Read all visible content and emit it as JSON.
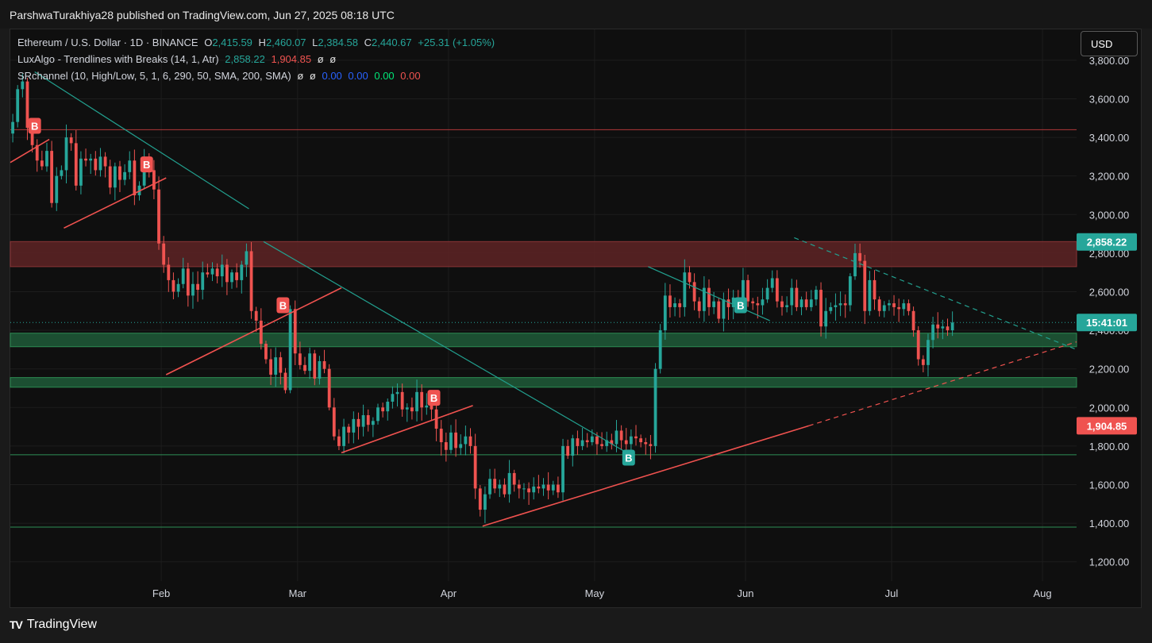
{
  "header": {
    "published_by": "ParshwaTurakhiya28 published on TradingView.com, Jun 27, 2025 08:18 UTC"
  },
  "legend": {
    "symbol": "Ethereum / U.S. Dollar · 1D · BINANCE",
    "o_label": "O",
    "o_value": "2,415.59",
    "h_label": "H",
    "h_value": "2,460.07",
    "l_label": "L",
    "l_value": "2,384.58",
    "c_label": "C",
    "c_value": "2,440.67",
    "change": "+25.31 (+1.05%)",
    "indicator1_name": "LuxAlgo - Trendlines with Breaks (14, 1, Atr)",
    "indicator1_v1": "2,858.22",
    "indicator1_v2": "1,904.85",
    "indicator1_v3": "ø",
    "indicator1_v4": "ø",
    "indicator2_name": "SRchannel (10, High/Low, 5, 1, 6, 290, 50, SMA, 200, SMA)",
    "indicator2_v1": "ø",
    "indicator2_v2": "ø",
    "indicator2_v3": "0.00",
    "indicator2_v4": "0.00",
    "indicator2_v5": "0.00",
    "indicator2_v6": "0.00"
  },
  "currency_button": "USD",
  "footer": {
    "logo": "TV",
    "name": "TradingView"
  },
  "colors": {
    "up": "#26a69a",
    "down": "#ef5350",
    "teal_line": "#22a08f",
    "red_line": "#f0524f",
    "zone_red": "#5e2325",
    "zone_green": "#1e5b38",
    "background": "#0f0f0f"
  },
  "chart_data": {
    "type": "candlestick",
    "symbol": "Ethereum / U.S. Dollar",
    "interval": "1D",
    "exchange": "BINANCE",
    "ylim": [
      1100,
      3960
    ],
    "y_ticks": [
      3800,
      3600,
      3400,
      3200,
      3000,
      2800,
      2600,
      2400,
      2200,
      2000,
      1800,
      1600,
      1400,
      1200
    ],
    "y_tick_labels": [
      "3,800.00",
      "3,600.00",
      "3,400.00",
      "3,200.00",
      "3,000.00",
      "2,800.00",
      "2,600.00",
      "2,400.00",
      "2,200.00",
      "2,000.00",
      "1,800.00",
      "1,600.00",
      "1,400.00",
      "1,200.00"
    ],
    "x_labels": [
      {
        "label": "Feb",
        "date": "2025-02-01"
      },
      {
        "label": "Mar",
        "date": "2025-03-01"
      },
      {
        "label": "Apr",
        "date": "2025-04-01"
      },
      {
        "label": "May",
        "date": "2025-05-01"
      },
      {
        "label": "Jun",
        "date": "2025-06-01"
      },
      {
        "label": "Jul",
        "date": "2025-07-01"
      },
      {
        "label": "Aug",
        "date": "2025-08-01"
      }
    ],
    "x_range": [
      "2025-01-01",
      "2025-08-08"
    ],
    "price_tags": [
      {
        "value": 2858.22,
        "label": "2,858.22",
        "color": "#26a69a"
      },
      {
        "value": 2440.67,
        "label": "15:41:01",
        "color": "#26a69a"
      },
      {
        "value": 1904.85,
        "label": "1,904.85",
        "color": "#ef5350"
      }
    ],
    "last_price": 2440.67,
    "closes": [
      3480,
      3650,
      3690,
      3450,
      3360,
      3280,
      3250,
      3330,
      3060,
      3200,
      3230,
      3400,
      3370,
      3150,
      3290,
      3280,
      3290,
      3230,
      3300,
      3250,
      3140,
      3250,
      3180,
      3220,
      3280,
      3100,
      3150,
      3300,
      3230,
      3130,
      2850,
      2740,
      2660,
      2600,
      2640,
      2720,
      2580,
      2640,
      2610,
      2700,
      2690,
      2720,
      2680,
      2740,
      2650,
      2700,
      2660,
      2740,
      2810,
      2500,
      2450,
      2330,
      2250,
      2170,
      2260,
      2180,
      2090,
      2510,
      2280,
      2220,
      2190,
      2280,
      2150,
      2240,
      2200,
      2000,
      1850,
      1800,
      1900,
      1870,
      1940,
      1900,
      1960,
      1910,
      1930,
      2000,
      1980,
      2030,
      2070,
      2080,
      1990,
      2000,
      1980,
      2080,
      2000,
      2010,
      1990,
      1890,
      1820,
      1780,
      1870,
      1790,
      1810,
      1850,
      1800,
      1580,
      1470,
      1550,
      1630,
      1580,
      1600,
      1550,
      1660,
      1600,
      1580,
      1580,
      1560,
      1590,
      1580,
      1600,
      1570,
      1600,
      1560,
      1800,
      1750,
      1840,
      1800,
      1830,
      1820,
      1850,
      1810,
      1800,
      1830,
      1810,
      1880,
      1830,
      1810,
      1850,
      1840,
      1820,
      1810,
      1800,
      2200,
      2400,
      2580,
      2520,
      2540,
      2520,
      2700,
      2650,
      2550,
      2500,
      2620,
      2520,
      2550,
      2460,
      2560,
      2520,
      2570,
      2560,
      2660,
      2550,
      2540,
      2530,
      2560,
      2620,
      2670,
      2550,
      2520,
      2530,
      2620,
      2520,
      2560,
      2520,
      2560,
      2610,
      2420,
      2500,
      2520,
      2530,
      2540,
      2530,
      2680,
      2800,
      2760,
      2500,
      2660,
      2560,
      2500,
      2530,
      2540,
      2520,
      2510,
      2540,
      2500,
      2400,
      2250,
      2220,
      2350,
      2430,
      2410,
      2420,
      2400,
      2440
    ],
    "zones": [
      {
        "type": "resistance",
        "low": 2730,
        "high": 2860
      },
      {
        "type": "support",
        "low": 2315,
        "high": 2385
      },
      {
        "type": "support",
        "low": 2105,
        "high": 2155
      }
    ],
    "horizontal_lines": [
      3440,
      1755,
      1380
    ],
    "trendlines": [
      {
        "color": "teal",
        "from": [
          "2025-01-06",
          3740
        ],
        "to": [
          "2025-02-19",
          3030
        ]
      },
      {
        "color": "teal",
        "from": [
          "2025-02-22",
          2860
        ],
        "to": [
          "2025-05-08",
          1760
        ]
      },
      {
        "color": "teal",
        "from": [
          "2025-05-12",
          2730
        ],
        "to": [
          "2025-06-06",
          2450
        ]
      },
      {
        "color": "teal",
        "style": "dashed",
        "from": [
          "2025-06-11",
          2880
        ],
        "to": [
          "2025-08-08",
          2300
        ]
      },
      {
        "color": "red",
        "from": [
          "2025-01-01",
          3270
        ],
        "to": [
          "2025-01-09",
          3390
        ]
      },
      {
        "color": "red",
        "from": [
          "2025-01-12",
          2930
        ],
        "to": [
          "2025-02-02",
          3190
        ]
      },
      {
        "color": "red",
        "from": [
          "2025-02-02",
          2170
        ],
        "to": [
          "2025-03-10",
          2620
        ]
      },
      {
        "color": "red",
        "from": [
          "2025-03-10",
          1765
        ],
        "to": [
          "2025-04-06",
          2010
        ]
      },
      {
        "color": "red",
        "from": [
          "2025-04-08",
          1385
        ],
        "to": [
          "2025-06-14",
          1905
        ]
      },
      {
        "color": "red",
        "style": "dashed",
        "from": [
          "2025-06-14",
          1905
        ],
        "to": [
          "2025-08-08",
          2340
        ]
      }
    ],
    "break_labels": [
      {
        "text": "B",
        "type": "bearish",
        "date": "2025-01-06",
        "value": 3460
      },
      {
        "text": "B",
        "type": "bearish",
        "date": "2025-01-29",
        "value": 3260
      },
      {
        "text": "B",
        "type": "bearish",
        "date": "2025-02-26",
        "value": 2530
      },
      {
        "text": "B",
        "type": "bearish",
        "date": "2025-03-29",
        "value": 2050
      },
      {
        "text": "B",
        "type": "bullish",
        "date": "2025-05-08",
        "value": 1740
      },
      {
        "text": "B",
        "type": "bullish",
        "date": "2025-05-31",
        "value": 2530
      }
    ],
    "grid": true
  }
}
